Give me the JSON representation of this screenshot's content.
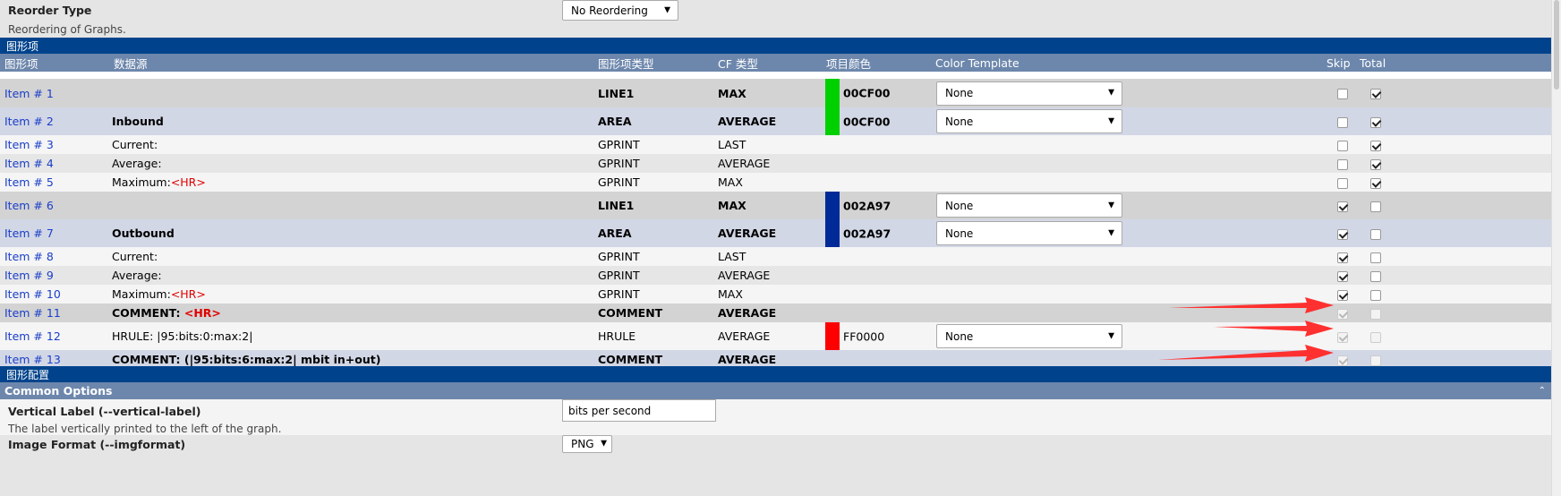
{
  "reorder": {
    "label": "Reorder Type",
    "description": "Reordering of Graphs.",
    "selected": "No Reordering"
  },
  "section_items_title": "图形项",
  "headers": [
    "图形项",
    "数据源",
    "图形项类型",
    "CF 类型",
    "项目颜色",
    "Color Template",
    "Skip",
    "Total"
  ],
  "rows": [
    {
      "item": "Item # 1",
      "source": "",
      "type": "LINE1",
      "cf": "MAX",
      "color_hex": "00CF00",
      "color": "#00cf00",
      "template": "None",
      "skip": false,
      "total": true
    },
    {
      "item": "Item # 2",
      "source": "Inbound",
      "type": "AREA",
      "cf": "AVERAGE",
      "color_hex": "00CF00",
      "color": "#00cf00",
      "template": "None",
      "skip": false,
      "total": true
    },
    {
      "item": "Item # 3",
      "source": "Current:",
      "type": "GPRINT",
      "cf": "LAST",
      "skip": false,
      "total": true
    },
    {
      "item": "Item # 4",
      "source": "Average:",
      "type": "GPRINT",
      "cf": "AVERAGE",
      "skip": false,
      "total": true
    },
    {
      "item": "Item # 5",
      "source": "Maximum:",
      "source_hr": "<HR>",
      "type": "GPRINT",
      "cf": "MAX",
      "skip": false,
      "total": true
    },
    {
      "item": "Item # 6",
      "source": "",
      "type": "LINE1",
      "cf": "MAX",
      "color_hex": "002A97",
      "color": "#002a97",
      "template": "None",
      "skip": true,
      "total": false
    },
    {
      "item": "Item # 7",
      "source": "Outbound",
      "type": "AREA",
      "cf": "AVERAGE",
      "color_hex": "002A97",
      "color": "#002a97",
      "template": "None",
      "skip": true,
      "total": false
    },
    {
      "item": "Item # 8",
      "source": "Current:",
      "type": "GPRINT",
      "cf": "LAST",
      "skip": true,
      "total": false
    },
    {
      "item": "Item # 9",
      "source": "Average:",
      "type": "GPRINT",
      "cf": "AVERAGE",
      "skip": true,
      "total": false
    },
    {
      "item": "Item # 10",
      "source": "Maximum:",
      "source_hr": "<HR>",
      "type": "GPRINT",
      "cf": "MAX",
      "skip": true,
      "total": false
    },
    {
      "item": "Item # 11",
      "source": "COMMENT: ",
      "source_hr": "<HR>",
      "type": "COMMENT",
      "cf": "AVERAGE",
      "skip": true,
      "total": false,
      "disabled": true
    },
    {
      "item": "Item # 12",
      "source": "HRULE: |95:bits:0:max:2|",
      "type": "HRULE",
      "cf": "AVERAGE",
      "color_hex": "FF0000",
      "color": "#ff0000",
      "template": "None",
      "skip": true,
      "total": false,
      "disabled": true
    },
    {
      "item": "Item # 13",
      "source": "COMMENT: (|95:bits:6:max:2| mbit in+out)",
      "type": "COMMENT",
      "cf": "AVERAGE",
      "skip": true,
      "total": false,
      "disabled": true
    }
  ],
  "section_config_title": "图形配置",
  "common_options_title": "Common Options",
  "collapse_icon": "chevron-up-icon",
  "vertical_label": {
    "label": "Vertical Label (--vertical-label)",
    "description": "The label vertically printed to the left of the graph.",
    "value": "bits per second"
  },
  "image_format": {
    "label": "Image Format (--imgformat)",
    "value": "PNG"
  }
}
